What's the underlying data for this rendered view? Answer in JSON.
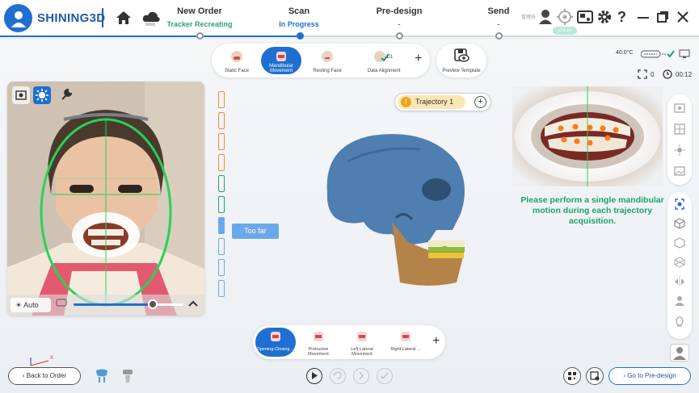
{
  "app": {
    "brand": "SHINING3D",
    "user_label": "管理员",
    "version_badge": "v3.0.xxx"
  },
  "steps": [
    {
      "title": "New Order",
      "status": "Tracker Recreating",
      "state": "done"
    },
    {
      "title": "Scan",
      "status": "In Progress",
      "state": "active"
    },
    {
      "title": "Pre-design",
      "status": "-",
      "state": "pending"
    },
    {
      "title": "Send",
      "status": "-",
      "state": "pending"
    }
  ],
  "scan_tools": {
    "items": [
      {
        "label": "Static Face",
        "active": false
      },
      {
        "label": "Mandibular Movement",
        "active": true
      },
      {
        "label": "Resting Face",
        "active": false
      },
      {
        "label": "Data Alignment",
        "active": false
      }
    ],
    "alignment_count": "1/1",
    "add_label": "+",
    "preview_label": "Preview Template"
  },
  "status": {
    "temperature": "40.0°C",
    "count": "0",
    "timer": "00:12"
  },
  "camera": {
    "auto_label": "Auto",
    "exposure_level": 0.72
  },
  "signal": {
    "bars": [
      {
        "state": "orange"
      },
      {
        "state": "orange"
      },
      {
        "state": "orange"
      },
      {
        "state": "orange"
      },
      {
        "state": "green"
      },
      {
        "state": "green"
      },
      {
        "state": "blue-filled"
      },
      {
        "state": "blue"
      },
      {
        "state": "blue"
      },
      {
        "state": "blue"
      }
    ],
    "hint": "Too far"
  },
  "trajectory": {
    "number": "!",
    "label": "Trajectory 1",
    "add_label": "+"
  },
  "instruction": "Please perform a single mandibular motion during each trajectory acquisition.",
  "motions": [
    {
      "label": "Opening-Closing ...",
      "active": true
    },
    {
      "label": "Protrusive Movement",
      "active": false
    },
    {
      "label": "Left Lateral Movement",
      "active": false
    },
    {
      "label": "Right Lateral ...",
      "active": false
    }
  ],
  "motion_add": "+",
  "nav": {
    "back_label": "Back to Order",
    "next_label": "Go to Pre-design"
  },
  "colors": {
    "accent": "#1f6fd1",
    "success": "#1ea46b",
    "warning": "#f0a41a",
    "skull": "#4f7fb0",
    "mandible": "#b3834a"
  },
  "axis": {
    "x": "X",
    "y": "Y"
  }
}
